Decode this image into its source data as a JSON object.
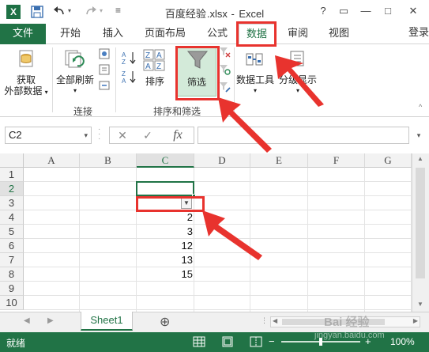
{
  "window": {
    "title_parts": [
      "百度经验",
      ".xlsx",
      " - ",
      "Excel"
    ],
    "controls": [
      "?",
      "▭",
      "—",
      "□",
      "✕"
    ]
  },
  "tabs": [
    "文件",
    "开始",
    "插入",
    "页面布局",
    "公式",
    "数据",
    "审阅",
    "视图"
  ],
  "active_tab_index": 5,
  "signin": "登录",
  "ribbon": {
    "get_data_label_1": "获取",
    "get_data_label_2": "外部数据",
    "refresh_all_label": "全部刷新",
    "connections_group": "连接",
    "sort_label": "排序",
    "filter_label": "筛选",
    "sort_filter_group": "排序和筛选",
    "data_tools_label": "数据工具",
    "outline_label": "分级显示"
  },
  "formula_bar": {
    "name_box": "C2",
    "fx": "fx",
    "value": ""
  },
  "sheet": {
    "columns": [
      "A",
      "B",
      "C",
      "D",
      "E",
      "F",
      "G"
    ],
    "selected_column": "C",
    "rows": [
      "1",
      "2",
      "3",
      "4",
      "5",
      "6",
      "7",
      "8",
      "9",
      "10"
    ],
    "selected_row": "2",
    "active_cell": "C2",
    "c_values": {
      "4": "2",
      "5": "3",
      "6": "12",
      "7": "13",
      "8": "15"
    }
  },
  "sheet_tabs": {
    "active": "Sheet1",
    "add_symbol": "⊕"
  },
  "status": {
    "ready": "就绪",
    "zoom": "100%"
  },
  "watermark": {
    "brand": "Bai 经验",
    "url": "jingyan.baidu.com"
  },
  "colors": {
    "excel_green": "#217346",
    "annotation_red": "#e8332e"
  }
}
